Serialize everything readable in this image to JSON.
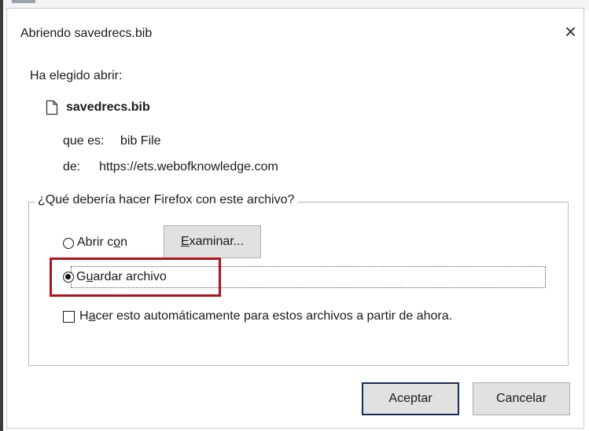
{
  "window": {
    "title": "Abriendo savedrecs.bib",
    "close_symbol": "×"
  },
  "info": {
    "intro": "Ha elegido abrir:",
    "filename": "savedrecs.bib",
    "type_label": "que es:",
    "type_value": "bib File",
    "from_label": "de:",
    "from_value": "https://ets.webofknowledge.com"
  },
  "question": {
    "legend": "¿Qué debería hacer Firefox con este archivo?",
    "open_with": {
      "pre": "Abrir c",
      "mnemonic": "o",
      "post": "n",
      "selected": false
    },
    "browse_button": {
      "mnemonic": "E",
      "post": "xaminar..."
    },
    "save_file": {
      "pre": "G",
      "mnemonic": "u",
      "post": "ardar archivo",
      "selected": true
    },
    "auto_checkbox": {
      "pre": "H",
      "mnemonic": "a",
      "post": "cer esto automáticamente para estos archivos a partir de ahora.",
      "checked": false
    }
  },
  "buttons": {
    "ok": "Aceptar",
    "cancel": "Cancelar"
  },
  "colors": {
    "highlight": "#b1131a",
    "default_button_border": "#1c2a5c"
  },
  "icons": [
    "file-icon",
    "close-icon"
  ]
}
